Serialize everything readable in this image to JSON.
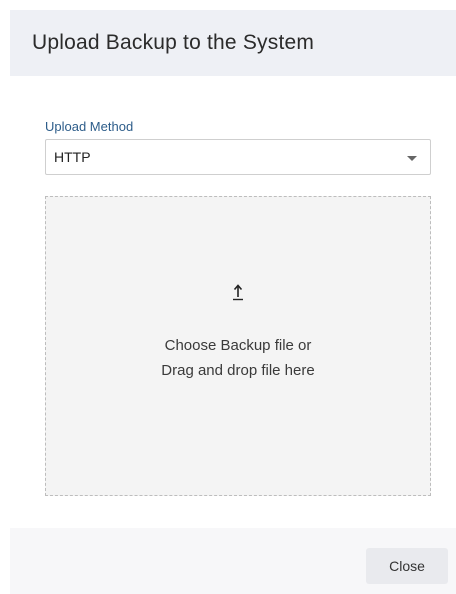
{
  "dialog": {
    "title": "Upload Backup to the System"
  },
  "upload_method": {
    "label": "Upload Method",
    "selected": "HTTP"
  },
  "dropzone": {
    "icon": "upload-arrow-icon",
    "line1": "Choose Backup file or",
    "line2": "Drag and drop file here"
  },
  "footer": {
    "close_label": "Close"
  }
}
